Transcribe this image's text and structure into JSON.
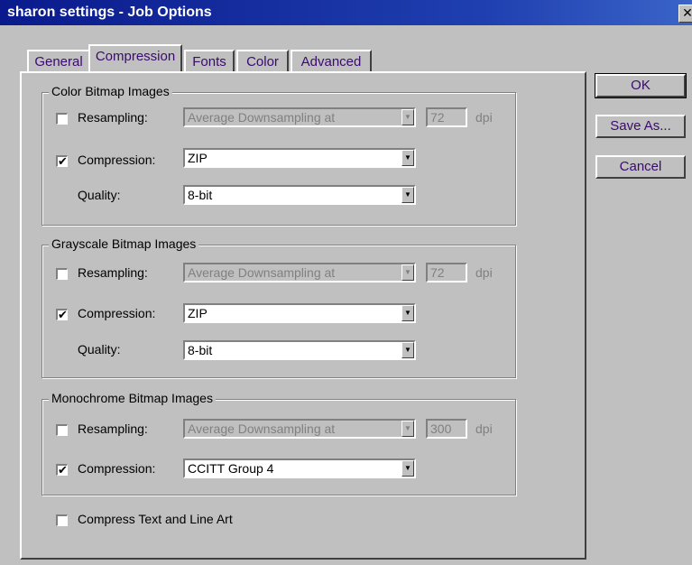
{
  "window": {
    "title": "sharon settings - Job Options",
    "close_glyph": "✕"
  },
  "tabs": [
    {
      "label": "General"
    },
    {
      "label": "Compression"
    },
    {
      "label": "Fonts"
    },
    {
      "label": "Color"
    },
    {
      "label": "Advanced"
    }
  ],
  "active_tab": "Compression",
  "buttons": {
    "ok": "OK",
    "save_as": "Save As...",
    "cancel": "Cancel"
  },
  "color_group": {
    "title": "Color Bitmap Images",
    "resampling": {
      "label": "Resampling:",
      "checked": false,
      "value": "Average Downsampling at",
      "dpi": "72",
      "unit": "dpi"
    },
    "compression": {
      "label": "Compression:",
      "checked": true,
      "value": "ZIP"
    },
    "quality": {
      "label": "Quality:",
      "value": "8-bit"
    }
  },
  "gray_group": {
    "title": "Grayscale Bitmap Images",
    "resampling": {
      "label": "Resampling:",
      "checked": false,
      "value": "Average Downsampling at",
      "dpi": "72",
      "unit": "dpi"
    },
    "compression": {
      "label": "Compression:",
      "checked": true,
      "value": "ZIP"
    },
    "quality": {
      "label": "Quality:",
      "value": "8-bit"
    }
  },
  "mono_group": {
    "title": "Monochrome Bitmap Images",
    "resampling": {
      "label": "Resampling:",
      "checked": false,
      "value": "Average Downsampling at",
      "dpi": "300",
      "unit": "dpi"
    },
    "compression": {
      "label": "Compression:",
      "checked": true,
      "value": "CCITT Group 4"
    }
  },
  "compress_text": {
    "label": "Compress Text and Line Art",
    "checked": false
  },
  "glyphs": {
    "check": "✔",
    "arrow": "▼"
  },
  "colors": {
    "titlebar": "#0a1a8c",
    "face": "#c0c0c0",
    "tab_text": "#3a0a6e"
  }
}
